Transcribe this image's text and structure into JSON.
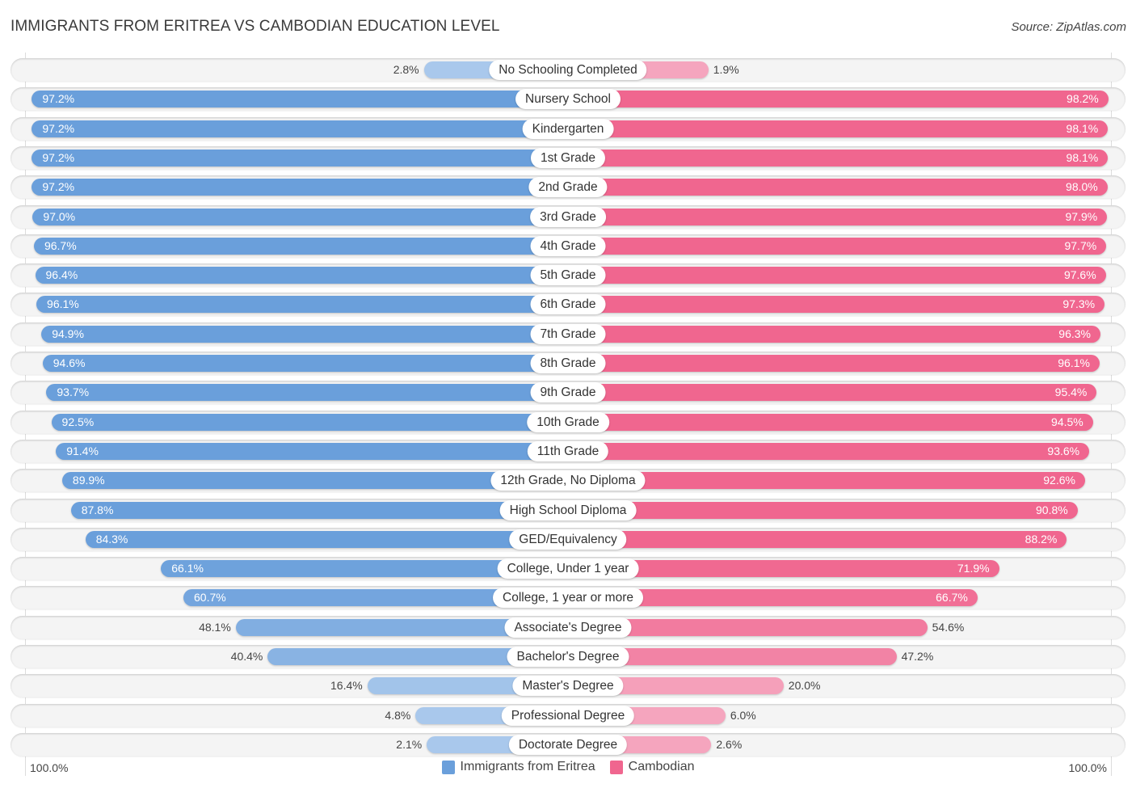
{
  "header": {
    "title": "IMMIGRANTS FROM ERITREA VS CAMBODIAN EDUCATION LEVEL",
    "source": "Source: ZipAtlas.com"
  },
  "colors": {
    "left_series": "#6a9fdb",
    "left_series_light": "#a9c8ec",
    "right_series": "#f0668f",
    "right_series_light": "#f5a5be"
  },
  "chart_data": {
    "type": "bar",
    "orientation": "horizontal-diverging",
    "title": "IMMIGRANTS FROM ERITREA VS CAMBODIAN EDUCATION LEVEL",
    "xlabel": "",
    "ylabel": "",
    "xlim": [
      0,
      100
    ],
    "axis_left_label": "100.0%",
    "axis_right_label": "100.0%",
    "legend_position": "bottom-center",
    "categories": [
      "No Schooling Completed",
      "Nursery School",
      "Kindergarten",
      "1st Grade",
      "2nd Grade",
      "3rd Grade",
      "4th Grade",
      "5th Grade",
      "6th Grade",
      "7th Grade",
      "8th Grade",
      "9th Grade",
      "10th Grade",
      "11th Grade",
      "12th Grade, No Diploma",
      "High School Diploma",
      "GED/Equivalency",
      "College, Under 1 year",
      "College, 1 year or more",
      "Associate's Degree",
      "Bachelor's Degree",
      "Master's Degree",
      "Professional Degree",
      "Doctorate Degree"
    ],
    "series": [
      {
        "name": "Immigrants from Eritrea",
        "side": "left",
        "values": [
          2.8,
          97.2,
          97.2,
          97.2,
          97.2,
          97.0,
          96.7,
          96.4,
          96.1,
          94.9,
          94.6,
          93.7,
          92.5,
          91.4,
          89.9,
          87.8,
          84.3,
          66.1,
          60.7,
          48.1,
          40.4,
          16.4,
          4.8,
          2.1
        ]
      },
      {
        "name": "Cambodian",
        "side": "right",
        "values": [
          1.9,
          98.2,
          98.1,
          98.1,
          98.0,
          97.9,
          97.7,
          97.6,
          97.3,
          96.3,
          96.1,
          95.4,
          94.5,
          93.6,
          92.6,
          90.8,
          88.2,
          71.9,
          66.7,
          54.6,
          47.2,
          20.0,
          6.0,
          2.6
        ]
      }
    ]
  }
}
